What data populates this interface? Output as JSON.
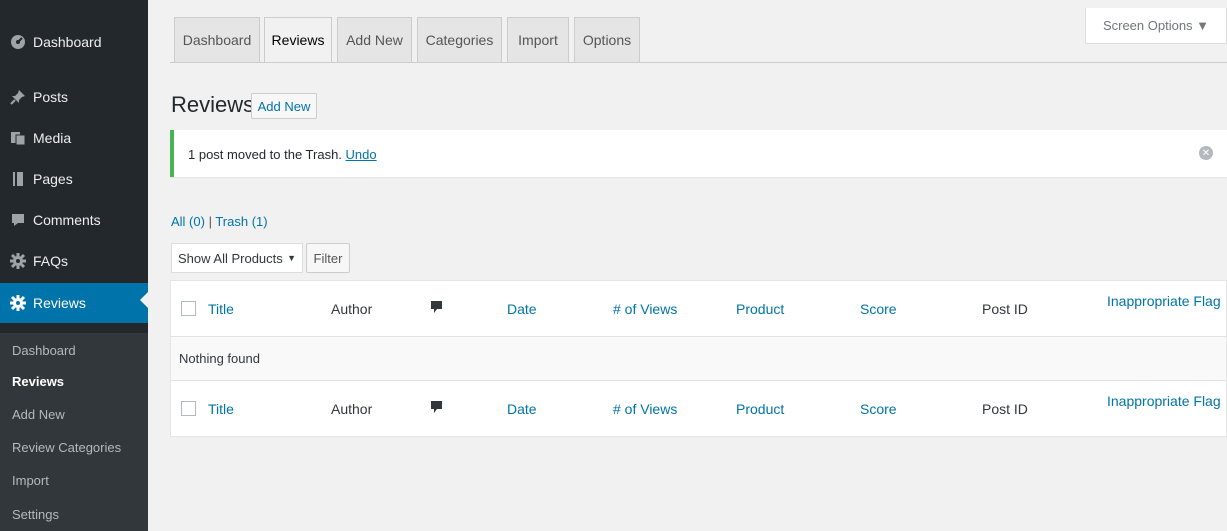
{
  "sidebar": {
    "items": [
      {
        "label": "Dashboard",
        "icon": "dashboard-icon"
      },
      {
        "label": "Posts",
        "icon": "pin-icon"
      },
      {
        "label": "Media",
        "icon": "media-icon"
      },
      {
        "label": "Pages",
        "icon": "pages-icon"
      },
      {
        "label": "Comments",
        "icon": "comment-icon"
      },
      {
        "label": "FAQs",
        "icon": "gear-icon"
      },
      {
        "label": "Reviews",
        "icon": "gear-icon"
      }
    ],
    "submenu": [
      "Dashboard",
      "Reviews",
      "Add New",
      "Review Categories",
      "Import",
      "Settings"
    ]
  },
  "tabs": [
    "Dashboard",
    "Reviews",
    "Add New",
    "Categories",
    "Import",
    "Options"
  ],
  "screen_options": "Screen Options ▼",
  "page": {
    "title": "Reviews",
    "add_new": "Add New"
  },
  "notice": {
    "text": "1 post moved to the Trash. ",
    "undo": "Undo",
    "dismiss": "✕"
  },
  "views": {
    "all": "All (0)",
    "sep": " | ",
    "trash": "Trash (1)"
  },
  "filter": {
    "select_value": "Show All Products",
    "button": "Filter"
  },
  "table": {
    "columns": {
      "title": "Title",
      "author": "Author",
      "date": "Date",
      "views": "# of Views",
      "product": "Product",
      "score": "Score",
      "post_id": "Post ID",
      "flag": "Inappropriate Flag"
    },
    "empty": "Nothing found"
  },
  "colors": {
    "sidebar": "#23282d",
    "accent": "#0073aa",
    "success": "#46b450"
  }
}
